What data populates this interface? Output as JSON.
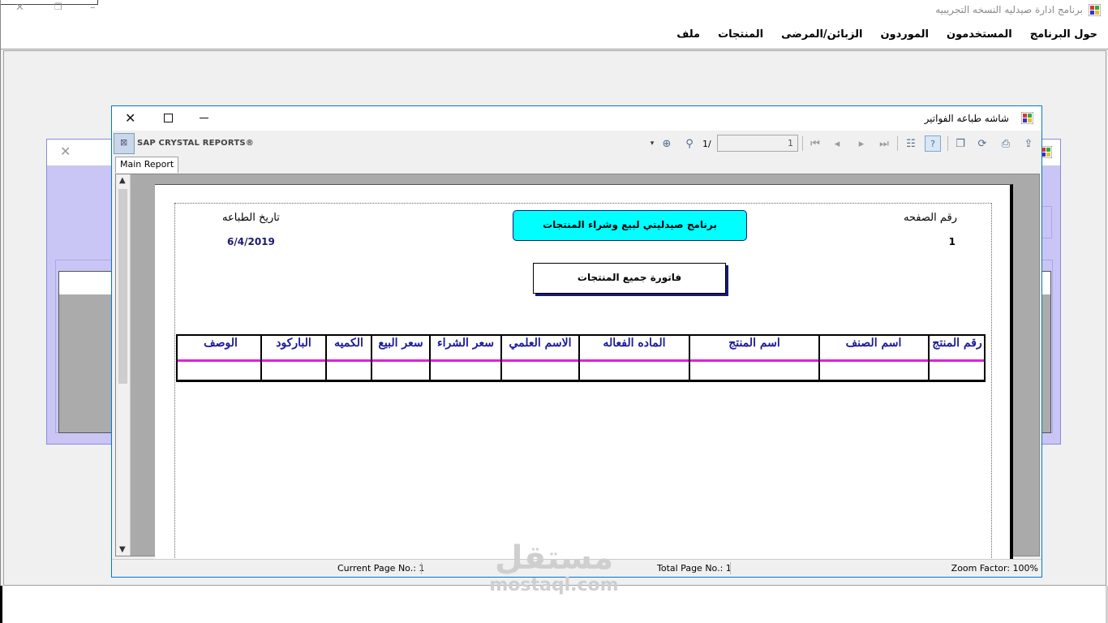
{
  "app": {
    "title": "برنامج ادارة صيدليه النسخه التجريبيه",
    "menu": [
      "ملف",
      "المنتجات",
      "الزبائن/المرضى",
      "الموردون",
      "المستخدمون",
      "حول البرنامج"
    ]
  },
  "print_window": {
    "title": "شاشه طباعه الفواتير",
    "brand": "SAP CRYSTAL REPORTS®",
    "page_input": "1",
    "page_of": "1/",
    "tab": "Main Report",
    "status": {
      "current_page": "Current Page No.: 1",
      "total_pages": "Total Page No.: 1",
      "zoom": "Zoom Factor: 100%"
    }
  },
  "report": {
    "page_number_label": "رقم الصفحه",
    "page_number_value": "1",
    "print_date_label": "تاريخ الطباعه",
    "print_date_value": "6/4/2019",
    "title": "برنامج صيدليتي لبيع وشراء المنتجات",
    "subtitle": "فاتورة جميع المنتجات",
    "columns": [
      "رقم المنتج",
      "اسم الصنف",
      "اسم المنتج",
      "الماده الفعاله",
      "الاسم العلمي",
      "سعر الشراء",
      "سعر البيع",
      "الكميه",
      "الباركود",
      "الوصف"
    ]
  },
  "watermark": {
    "arabic": "مستقل",
    "latin": "mostaql.com"
  },
  "icons": {
    "close": "close-icon",
    "maximize": "maximize-icon",
    "minimize": "minimize-icon"
  },
  "colors": {
    "title_box": "#00ffff",
    "header_text": "#1a1a9a",
    "separator": "#e020e0",
    "bg_window": "#c9c6f5"
  }
}
